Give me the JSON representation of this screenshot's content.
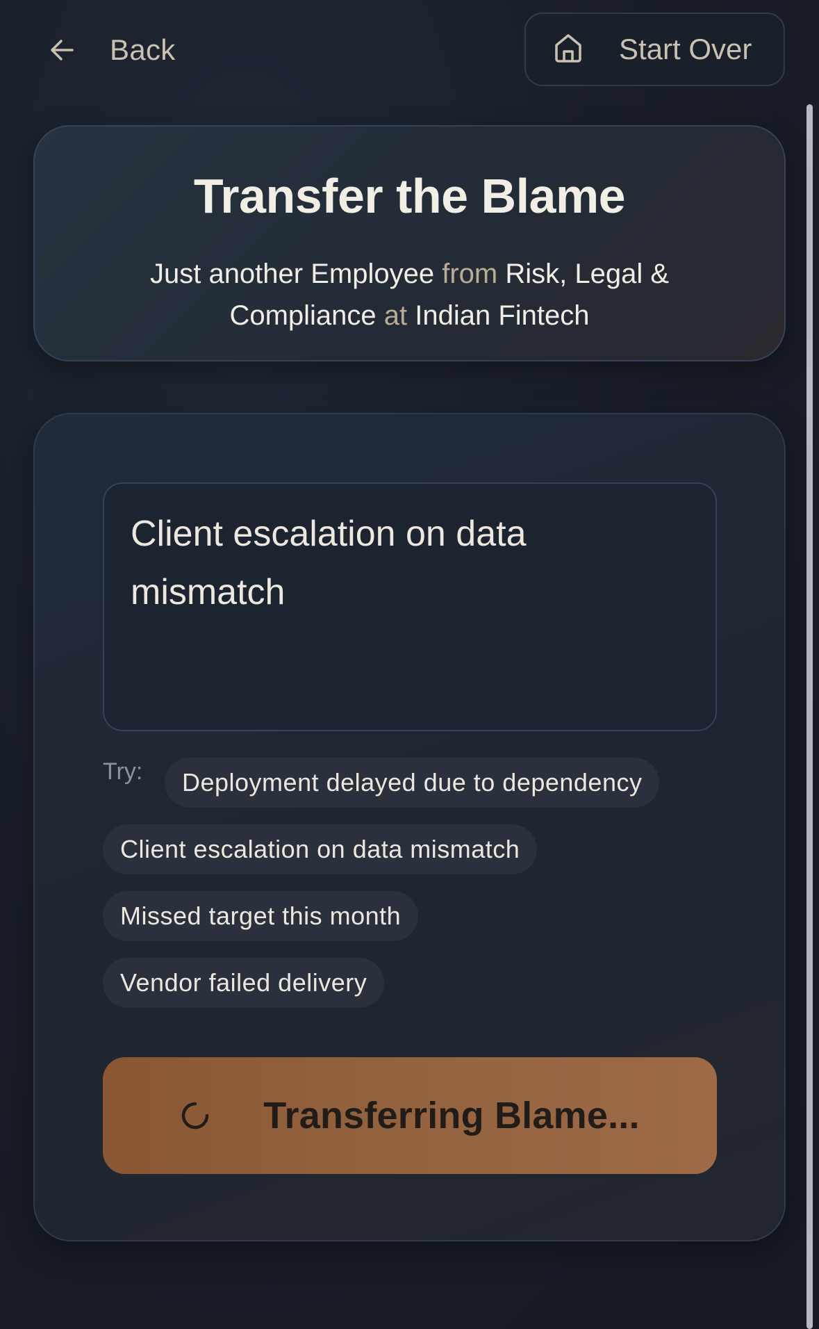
{
  "nav": {
    "back_label": "Back",
    "start_over_label": "Start Over",
    "back_icon": "arrow-left-icon",
    "home_icon": "home-icon"
  },
  "header": {
    "title": "Transfer the Blame",
    "subtitle": {
      "part1": "Just another Employee",
      "connector1": "from",
      "part2": "Risk, Legal & Compliance",
      "connector2": "at",
      "part3": "Indian Fintech"
    }
  },
  "form": {
    "input_value": "Client escalation on data mismatch",
    "try_label": "Try:",
    "suggestions": [
      "Deployment delayed due to dependency",
      "Client escalation on data mismatch",
      "Missed target this month",
      "Vendor failed delivery"
    ],
    "submit_label": "Transferring Blame...",
    "submit_icon": "spinner-icon"
  },
  "colors": {
    "background": "#181d27",
    "accent": "#93633f",
    "text": "#f1eee6",
    "muted": "#b9ae94"
  }
}
